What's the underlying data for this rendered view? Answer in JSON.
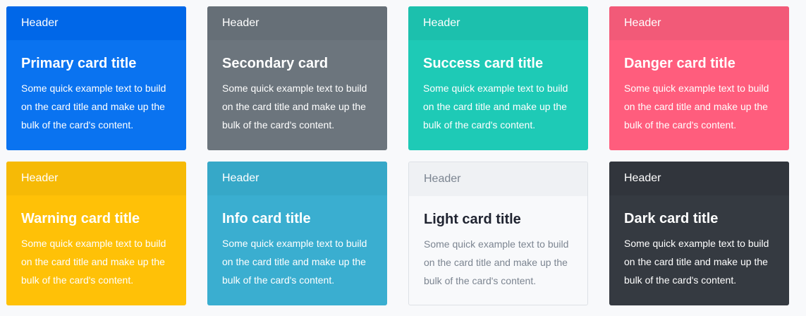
{
  "cards": [
    {
      "header": "Header",
      "title": "Primary card title",
      "text": "Some quick example text to build on the card title and make up the bulk of the card's content.",
      "bg": "#0a73f0",
      "header_bg": "#0067e8",
      "color": "#ffffff",
      "text_color": "#ffffff",
      "header_color": "#ffffff"
    },
    {
      "header": "Header",
      "title": "Secondary card",
      "text": "Some quick example text to build on the card title and make up the bulk of the card's content.",
      "bg": "#6c757d",
      "header_bg": "#666f77",
      "color": "#ffffff",
      "text_color": "#ffffff",
      "header_color": "#ffffff"
    },
    {
      "header": "Header",
      "title": "Success card title",
      "text": "Some quick example text to build on the card title and make up the bulk of the card's content.",
      "bg": "#1ecab6",
      "header_bg": "#1cc0ad",
      "color": "#ffffff",
      "text_color": "#ffffff",
      "header_color": "#ffffff"
    },
    {
      "header": "Header",
      "title": "Danger card title",
      "text": "Some quick example text to build on the card title and make up the bulk of the card's content.",
      "bg": "#ff5d7d",
      "header_bg": "#f25a78",
      "color": "#ffffff",
      "text_color": "#ffffff",
      "header_color": "#ffffff"
    },
    {
      "header": "Header",
      "title": "Warning card title",
      "text": "Some quick example text to build on the card title and make up the bulk of the card's content.",
      "bg": "#ffc107",
      "header_bg": "#f6ba06",
      "color": "#ffffff",
      "text_color": "#ffffff",
      "header_color": "#ffffff"
    },
    {
      "header": "Header",
      "title": "Info card title",
      "text": "Some quick example text to build on the card title and make up the bulk of the card's content.",
      "bg": "#3aaed0",
      "header_bg": "#36a8c8",
      "color": "#ffffff",
      "text_color": "#ffffff",
      "header_color": "#ffffff"
    },
    {
      "header": "Header",
      "title": "Light card title",
      "text": "Some quick example text to build on the card title and make up the bulk of the card's content.",
      "bg": "#f8f9fb",
      "header_bg": "#eff1f4",
      "color": "#1f2330",
      "text_color": "#7c8591",
      "header_color": "#7c8591"
    },
    {
      "header": "Header",
      "title": "Dark card title",
      "text": "Some quick example text to build on the card title and make up the bulk of the card's content.",
      "bg": "#353a41",
      "header_bg": "#31353c",
      "color": "#ffffff",
      "text_color": "#ffffff",
      "header_color": "#ffffff"
    }
  ]
}
